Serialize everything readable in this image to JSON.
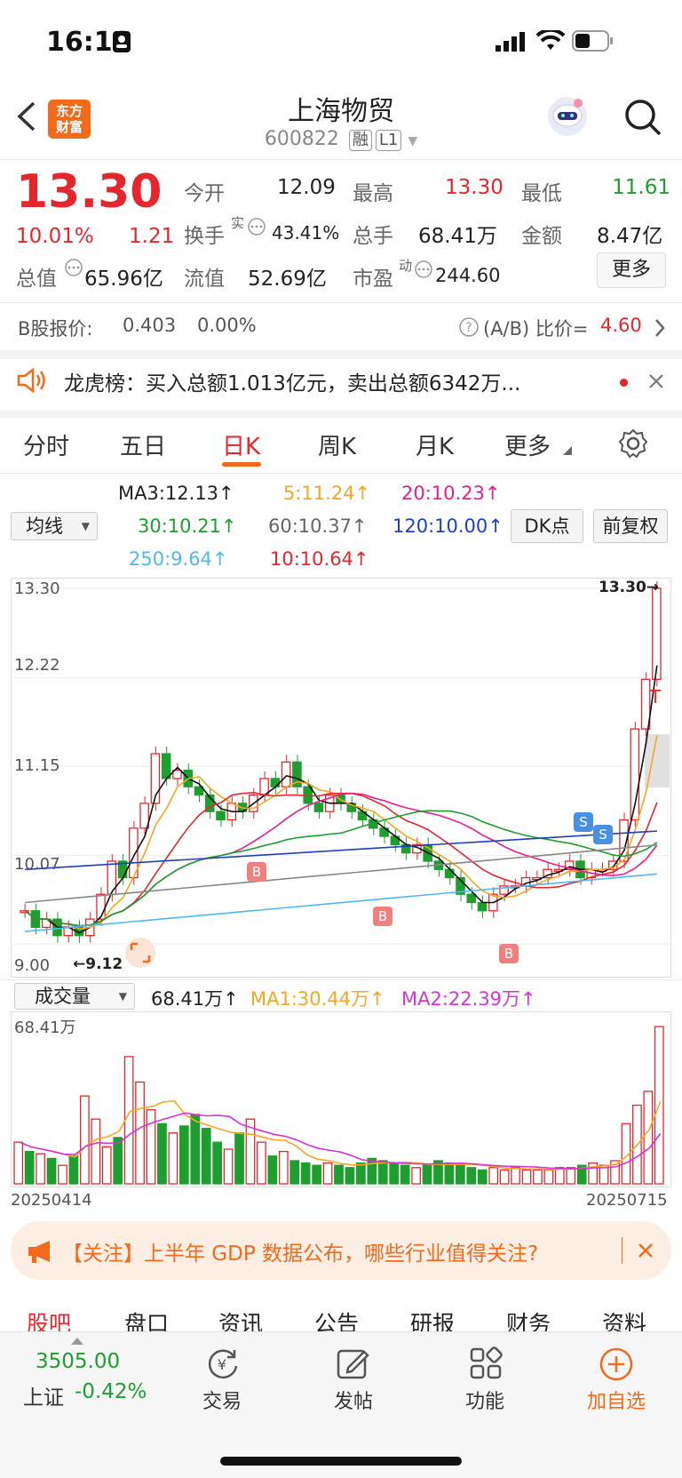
{
  "status": {
    "time": "16:11"
  },
  "header": {
    "title": "上海物贸",
    "code": "600822",
    "tag1": "融",
    "tag2": "L1",
    "logo_line1": "东方",
    "logo_line2": "财富"
  },
  "quote": {
    "price": "13.30",
    "pct": "10.01%",
    "change": "1.21",
    "open_label": "今开",
    "open": "12.09",
    "high_label": "最高",
    "high": "13.30",
    "low_label": "最低",
    "low": "11.61",
    "turnover_label": "换手",
    "turnover_sup": "实",
    "turnover": "43.41%",
    "volume_label": "总手",
    "volume": "68.41万",
    "amount_label": "金额",
    "amount": "8.47亿",
    "mktcap_label": "总值",
    "mktcap": "65.96亿",
    "float_label": "流值",
    "float": "52.69亿",
    "pe_label": "市盈",
    "pe_sup": "动",
    "pe": "244.60",
    "more": "更多"
  },
  "bshare": {
    "label": "B股报价:",
    "price": "0.403",
    "pct": "0.00%",
    "ratio_label": "(A/B) 比价=",
    "ratio": "4.60"
  },
  "dragon": {
    "text": "龙虎榜：买入总额1.013亿元，卖出总额6342万..."
  },
  "ktabs": [
    "分时",
    "五日",
    "日K",
    "周K",
    "月K",
    "更多"
  ],
  "ma": {
    "ma3": "MA3:12.13↑",
    "ma5": "5:11.24↑",
    "ma20": "20:10.23↑",
    "ma30": "30:10.21↑",
    "ma60": "60:10.37↑",
    "ma120": "120:10.00↑",
    "ma250": "250:9.64↑",
    "ma10": "10:10.64↑",
    "avg_btn": "均线",
    "dk_btn": "DK点",
    "fq_btn": "前复权"
  },
  "price_axis": [
    "13.30",
    "12.22",
    "11.15",
    "10.07",
    "9.00"
  ],
  "annotations": {
    "high_mark": "13.30→",
    "low_mark": "←9.12",
    "t_mark": "T",
    "b": "B",
    "s": "S"
  },
  "volume": {
    "selector": "成交量",
    "vol": "68.41万↑",
    "ma1": "MA1:30.44万↑",
    "ma2": "MA2:22.39万↑",
    "axis_max": "68.41万",
    "date_start": "20250414",
    "date_end": "20250715"
  },
  "news": {
    "text": "【关注】上半年 GDP 数据公布，哪些行业值得关注?"
  },
  "bottom_tabs": [
    "股吧",
    "盘口",
    "资讯",
    "公告",
    "研报",
    "财务",
    "资料"
  ],
  "index": {
    "value": "3505.00",
    "name": "上证",
    "pct": "-0.42%"
  },
  "nav": [
    "交易",
    "发帖",
    "功能",
    "加自选"
  ],
  "colors": {
    "red": "#e5262d",
    "green": "#1e9e2e",
    "accent": "#f26a1b"
  }
}
